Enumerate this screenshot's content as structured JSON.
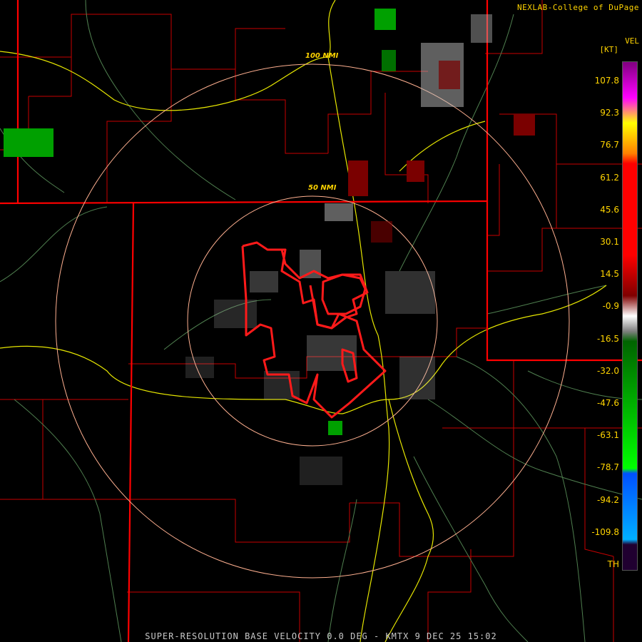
{
  "header": {
    "credit": "NEXLAB-College of DuPage"
  },
  "footer": {
    "caption": "SUPER-RESOLUTION BASE VELOCITY 0.0 DEG - KMTX 9 DEC 25 15:02"
  },
  "range_rings": {
    "inner_label": "50 NMI",
    "outer_label": "100 NMI"
  },
  "legend": {
    "product": "VEL",
    "unit": "[KT]",
    "ticks": [
      "107.8",
      "92.3",
      "76.7",
      "61.2",
      "45.6",
      "30.1",
      "14.5",
      "-0.9",
      "-16.5",
      "-32.0",
      "-47.6",
      "-63.1",
      "-78.7",
      "-94.2",
      "-109.8",
      "TH"
    ]
  },
  "colors": {
    "state_border": "#ff0000",
    "county_border": "#c80000",
    "highway": "#e6e600",
    "road": "#5a8a5a",
    "range_ring": "#ffb090",
    "warning_polygon": "#ff1a1a",
    "scale_stops": [
      "#800080",
      "#ff00ff",
      "#ffff00",
      "#ff8000",
      "#ff0000",
      "#800000",
      "#ffffff",
      "#808080",
      "#006400",
      "#00c000",
      "#00ff00",
      "#0050ff",
      "#00b0ff"
    ]
  }
}
